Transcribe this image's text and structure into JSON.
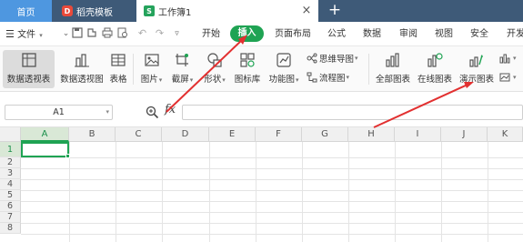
{
  "titlebar": {
    "tabs": [
      {
        "label": "首页"
      },
      {
        "label": "稻壳模板",
        "icon": "daoke-icon",
        "icon_glyph": "D"
      },
      {
        "label": "工作簿1",
        "icon": "spreadsheet-icon",
        "icon_glyph": "S"
      }
    ],
    "close_glyph": "×",
    "new_tab_glyph": "+"
  },
  "menubar": {
    "file_label": "文件",
    "items": [
      "开始",
      "插入",
      "页面布局",
      "公式",
      "数据",
      "审阅",
      "视图",
      "安全",
      "开发"
    ],
    "active": "插入"
  },
  "ribbon": {
    "buttons": [
      {
        "label": "数据透视表",
        "icon": "pivot-table-icon",
        "active": true
      },
      {
        "label": "数据透视图",
        "icon": "pivot-chart-icon"
      },
      {
        "label": "表格",
        "icon": "table-icon"
      },
      {
        "label": "图片",
        "icon": "picture-icon",
        "dropdown": true
      },
      {
        "label": "截屏",
        "icon": "screenshot-icon",
        "dropdown": true
      },
      {
        "label": "形状",
        "icon": "shape-icon",
        "dropdown": true
      },
      {
        "label": "图标库",
        "icon": "icon-library-icon"
      },
      {
        "label": "功能图",
        "icon": "function-chart-icon",
        "dropdown": true
      },
      {
        "label": "全部图表",
        "icon": "all-charts-icon"
      },
      {
        "label": "在线图表",
        "icon": "online-chart-icon"
      },
      {
        "label": "演示图表",
        "icon": "demo-chart-icon"
      }
    ],
    "small_buttons": [
      {
        "label": "思维导图",
        "icon": "mindmap-icon",
        "dropdown": true
      },
      {
        "label": "流程图",
        "icon": "flowchart-icon",
        "dropdown": true
      }
    ]
  },
  "formula_bar": {
    "cell_ref": "A1",
    "fx_label": "fx",
    "formula_value": ""
  },
  "sheet": {
    "columns": [
      "A",
      "B",
      "C",
      "D",
      "E",
      "F",
      "G",
      "H",
      "I",
      "J",
      "K"
    ],
    "rows": [
      "1",
      "2",
      "3",
      "4",
      "5",
      "6",
      "7",
      "8"
    ],
    "selected_cell": "A1"
  },
  "colors": {
    "accent_green": "#1fa353",
    "titlebar": "#3e5a78",
    "home_tab": "#4e97e0",
    "annotation_red": "#e23030"
  }
}
